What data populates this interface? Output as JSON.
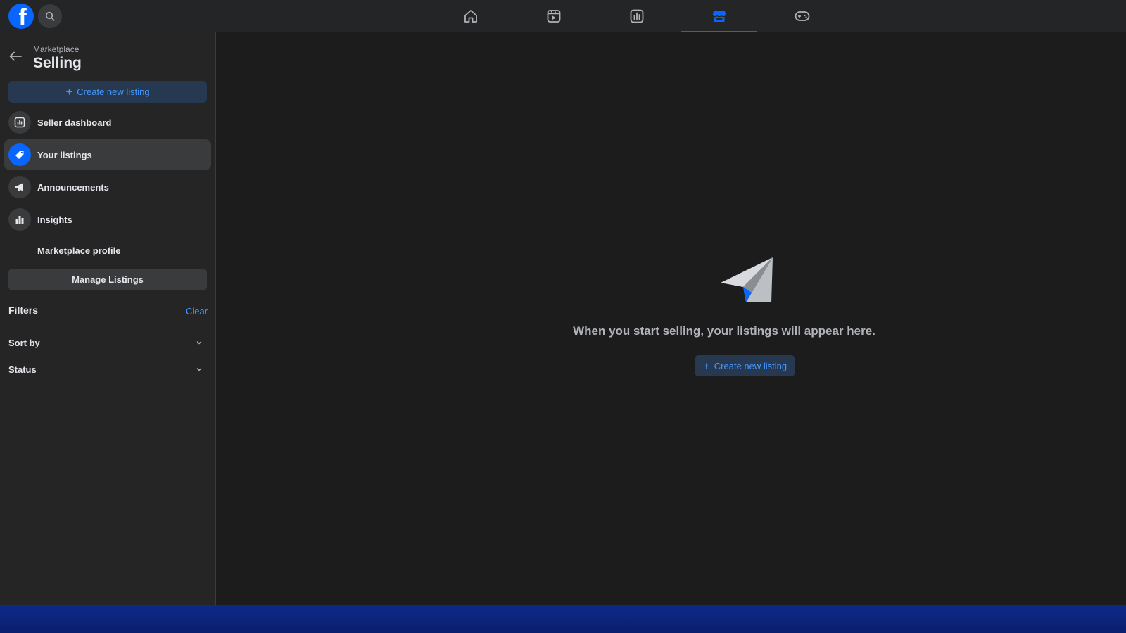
{
  "app": {
    "logo_letter": "f",
    "brand_color": "#0866ff"
  },
  "topbar": {
    "tabs": [
      {
        "name": "home",
        "icon": "home-icon",
        "active": false
      },
      {
        "name": "video",
        "icon": "video-icon",
        "active": false
      },
      {
        "name": "feeds",
        "icon": "feeds-icon",
        "active": false
      },
      {
        "name": "marketplace",
        "icon": "marketplace-icon",
        "active": true
      },
      {
        "name": "gaming",
        "icon": "gaming-icon",
        "active": false
      }
    ]
  },
  "sidebar": {
    "breadcrumb": "Marketplace",
    "title": "Selling",
    "create_label": "Create new listing",
    "items": [
      {
        "label": "Seller dashboard",
        "icon": "dashboard-icon",
        "active": false
      },
      {
        "label": "Your listings",
        "icon": "tag-icon",
        "active": true
      },
      {
        "label": "Announcements",
        "icon": "megaphone-icon",
        "active": false
      },
      {
        "label": "Insights",
        "icon": "bar-chart-icon",
        "active": false
      },
      {
        "label": "Marketplace profile",
        "icon": "",
        "active": false
      }
    ],
    "manage_label": "Manage Listings",
    "filters_title": "Filters",
    "clear_label": "Clear",
    "filters": [
      {
        "label": "Sort by"
      },
      {
        "label": "Status"
      }
    ]
  },
  "main": {
    "empty_message": "When you start selling, your listings will appear here.",
    "create_label": "Create new listing"
  },
  "colors": {
    "accent": "#0866ff",
    "link": "#4599ff",
    "background": "#1c1c1d",
    "sidebar": "#252526"
  }
}
